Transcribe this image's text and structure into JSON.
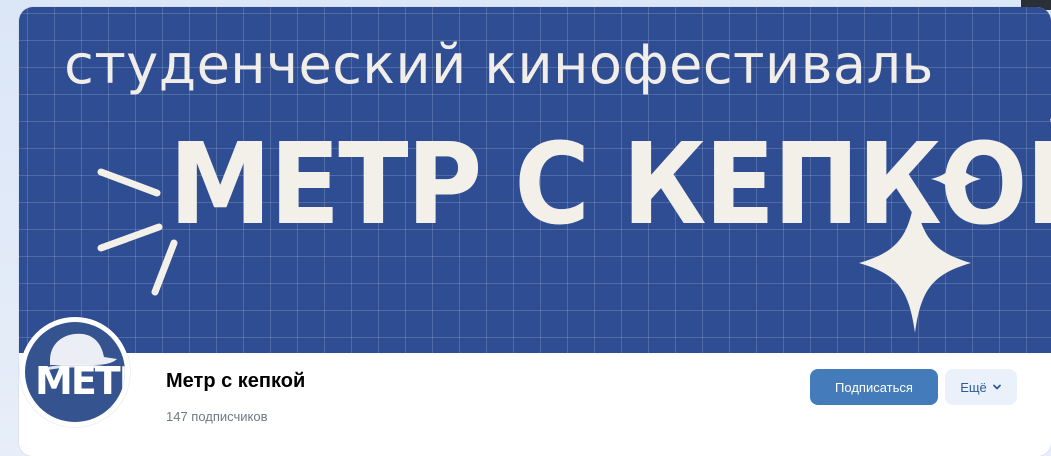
{
  "cover": {
    "subtitle": "студенческий кинофестиваль",
    "title": "МЕТР С КЕПКОЙ",
    "background_color": "#2f4d93"
  },
  "group": {
    "name": "Метр с кепкой",
    "subscribers": "147 подписчиков",
    "avatar_text": "МЕТР"
  },
  "actions": {
    "subscribe_label": "Подписаться",
    "more_label": "Ещё",
    "more_icon": "chevron-down-icon",
    "accent_color": "#447bba"
  }
}
